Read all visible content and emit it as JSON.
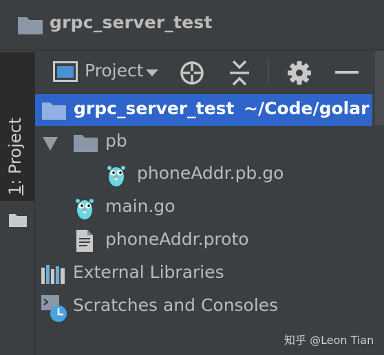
{
  "window": {
    "title": "grpc_server_test"
  },
  "side_tab": {
    "number": "1",
    "label_rest": ": Project"
  },
  "toolbar": {
    "view_label": "Project"
  },
  "tree": {
    "root_name": "grpc_server_test",
    "root_path": "~/Code/golar",
    "items": [
      {
        "label": "pb",
        "icon": "folder-icon"
      },
      {
        "label": "phoneAddr.pb.go",
        "icon": "gopher-file-icon"
      },
      {
        "label": "main.go",
        "icon": "gopher-file-icon"
      },
      {
        "label": "phoneAddr.proto",
        "icon": "text-file-icon"
      },
      {
        "label": "External Libraries",
        "icon": "libraries-icon"
      },
      {
        "label": "Scratches and Consoles",
        "icon": "scratches-icon"
      }
    ]
  },
  "watermark": "知乎 @Leon Tian",
  "colors": {
    "background": "#3c3f41",
    "selection": "#2f65ca",
    "folder": "#8a97a6"
  }
}
